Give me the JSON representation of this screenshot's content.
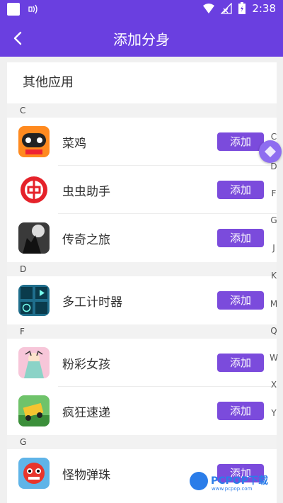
{
  "status_bar": {
    "time": "2:38"
  },
  "app_bar": {
    "title": "添加分身"
  },
  "card": {
    "header": "其他应用"
  },
  "add_label": "添加",
  "sections": [
    {
      "letter": "C",
      "apps": [
        {
          "name": "菜鸡",
          "icon": "caiji-app-icon"
        },
        {
          "name": "虫虫助手",
          "icon": "chongchong-app-icon"
        },
        {
          "name": "传奇之旅",
          "icon": "chuanqi-app-icon"
        }
      ]
    },
    {
      "letter": "D",
      "apps": [
        {
          "name": "多工计时器",
          "icon": "timer-app-icon"
        }
      ]
    },
    {
      "letter": "F",
      "apps": [
        {
          "name": "粉彩女孩",
          "icon": "fencai-app-icon"
        },
        {
          "name": "疯狂速递",
          "icon": "fengkuang-app-icon"
        }
      ]
    },
    {
      "letter": "G",
      "apps": [
        {
          "name": "怪物弹珠",
          "icon": "guaiwu-app-icon"
        }
      ]
    }
  ],
  "index_letters": [
    "C",
    "D",
    "F",
    "G",
    "J",
    "K",
    "M",
    "Q",
    "W",
    "X",
    "Y"
  ],
  "watermark": {
    "brand": "PCPOP下载",
    "sub": "www.pcpop.com"
  },
  "colors": {
    "primary": "#6a3fe0",
    "button": "#7b4bdc"
  }
}
